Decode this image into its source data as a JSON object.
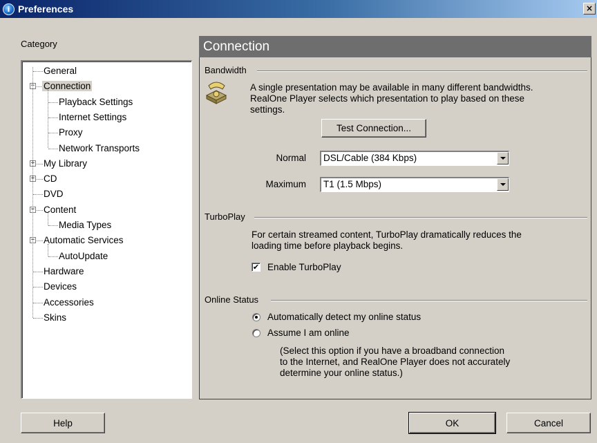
{
  "window": {
    "title": "Preferences",
    "close_glyph": "×",
    "title_icon_glyph": "i"
  },
  "sidebar": {
    "category_label": "Category",
    "items": [
      {
        "label": "General",
        "level": 0
      },
      {
        "label": "Connection",
        "level": 0,
        "expander": "−",
        "selected": true
      },
      {
        "label": "Playback Settings",
        "level": 1
      },
      {
        "label": "Internet Settings",
        "level": 1
      },
      {
        "label": "Proxy",
        "level": 1
      },
      {
        "label": "Network Transports",
        "level": 1
      },
      {
        "label": "My Library",
        "level": 0,
        "expander": "+"
      },
      {
        "label": "CD",
        "level": 0,
        "expander": "+"
      },
      {
        "label": "DVD",
        "level": 0
      },
      {
        "label": "Content",
        "level": 0,
        "expander": "−"
      },
      {
        "label": "Media Types",
        "level": 1
      },
      {
        "label": "Automatic Services",
        "level": 0,
        "expander": "−"
      },
      {
        "label": "AutoUpdate",
        "level": 1
      },
      {
        "label": "Hardware",
        "level": 0
      },
      {
        "label": "Devices",
        "level": 0
      },
      {
        "label": "Accessories",
        "level": 0
      },
      {
        "label": "Skins",
        "level": 0
      }
    ]
  },
  "main": {
    "heading": "Connection",
    "bandwidth": {
      "group_title": "Bandwidth",
      "icon": "telephone-icon",
      "description_line1": "A single presentation may be available in many different bandwidths.",
      "description_line2": "RealOne Player selects which presentation to play based on these",
      "description_line3": "settings.",
      "test_button": "Test Connection...",
      "normal_label": "Normal",
      "normal_value": "DSL/Cable (384 Kbps)",
      "maximum_label": "Maximum",
      "maximum_value": "T1 (1.5 Mbps)"
    },
    "turboplay": {
      "group_title": "TurboPlay",
      "description_line1": "For certain streamed content, TurboPlay dramatically reduces the",
      "description_line2": "loading time before playback begins.",
      "checkbox_label": "Enable TurboPlay",
      "checkbox_checked": true
    },
    "online_status": {
      "group_title": "Online Status",
      "option_auto": "Automatically detect my online status",
      "option_online": "Assume I am online",
      "selected": "auto",
      "note_line1": "(Select this option if you have a broadband connection",
      "note_line2": "to the Internet, and RealOne Player does not accurately",
      "note_line3": "determine your online status.)"
    }
  },
  "footer": {
    "help_button": "Help",
    "ok_button": "OK",
    "cancel_button": "Cancel"
  },
  "colors": {
    "title_gradient_start": "#0a246a",
    "header_bg": "#6e6e6e",
    "face": "#d4d0c8"
  }
}
